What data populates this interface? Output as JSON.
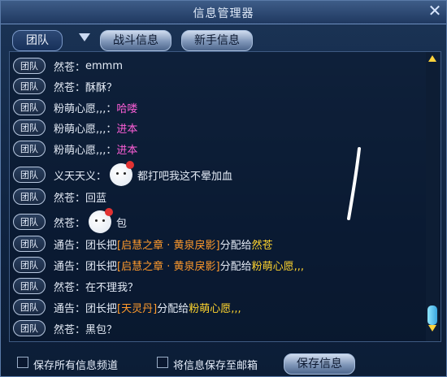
{
  "window": {
    "title": "信息管理器"
  },
  "tabs": [
    {
      "label": "团队"
    },
    {
      "label": "战斗信息"
    },
    {
      "label": "新手信息"
    }
  ],
  "badge_label": "团队",
  "messages": [
    {
      "sender": "然苍：",
      "parts": [
        {
          "text": "emmm",
          "color": "#e4ebf6"
        }
      ]
    },
    {
      "sender": "然苍：",
      "parts": [
        {
          "text": "酥酥？",
          "color": "#e4ebf6"
        }
      ]
    },
    {
      "sender": "粉萌心愿,,,：",
      "parts": [
        {
          "text": "哈喽",
          "color": "#ff5fd8"
        }
      ]
    },
    {
      "sender": "粉萌心愿,,,：",
      "parts": [
        {
          "text": "进本",
          "color": "#ff5fd8"
        }
      ]
    },
    {
      "sender": "粉萌心愿,,,：",
      "parts": [
        {
          "text": "进本",
          "color": "#ff5fd8"
        }
      ]
    },
    {
      "sender": "义天天义：",
      "emoji": "face-emoji",
      "parts": [
        {
          "text": "都打吧我这不晕加血",
          "color": "#e4ebf6"
        }
      ]
    },
    {
      "sender": "然苍：",
      "parts": [
        {
          "text": "回蓝",
          "color": "#e4ebf6"
        }
      ]
    },
    {
      "sender": "然苍：",
      "emoji": "face-emoji",
      "parts": [
        {
          "text": "包",
          "color": "#e4ebf6"
        }
      ]
    },
    {
      "sender": "通告：",
      "parts": [
        {
          "text": "团长把",
          "color": "#e4ebf6"
        },
        {
          "text": "[启慧之章 · 黄泉戾影]",
          "color": "#ff9a2c"
        },
        {
          "text": "分配给",
          "color": "#e4ebf6"
        },
        {
          "text": "然苍",
          "color": "#ffd52e"
        }
      ]
    },
    {
      "sender": "通告：",
      "parts": [
        {
          "text": "团长把",
          "color": "#e4ebf6"
        },
        {
          "text": "[启慧之章 · 黄泉戾影]",
          "color": "#ff9a2c"
        },
        {
          "text": "分配给",
          "color": "#e4ebf6"
        },
        {
          "text": "粉萌心愿,,,",
          "color": "#ffd52e"
        }
      ]
    },
    {
      "sender": "然苍：",
      "parts": [
        {
          "text": "在不理我？",
          "color": "#e4ebf6"
        }
      ]
    },
    {
      "sender": "通告：",
      "parts": [
        {
          "text": "团长把",
          "color": "#e4ebf6"
        },
        {
          "text": "[天灵丹]",
          "color": "#ff9a2c"
        },
        {
          "text": "分配给",
          "color": "#e4ebf6"
        },
        {
          "text": "粉萌心愿,,,",
          "color": "#ffd52e"
        }
      ]
    },
    {
      "sender": "然苍：",
      "parts": [
        {
          "text": "黑包？",
          "color": "#e4ebf6"
        }
      ]
    }
  ],
  "bottom": {
    "checkbox1_label": "保存所有信息频道",
    "checkbox2_label": "将信息保存至邮箱",
    "save_label": "保存信息"
  }
}
